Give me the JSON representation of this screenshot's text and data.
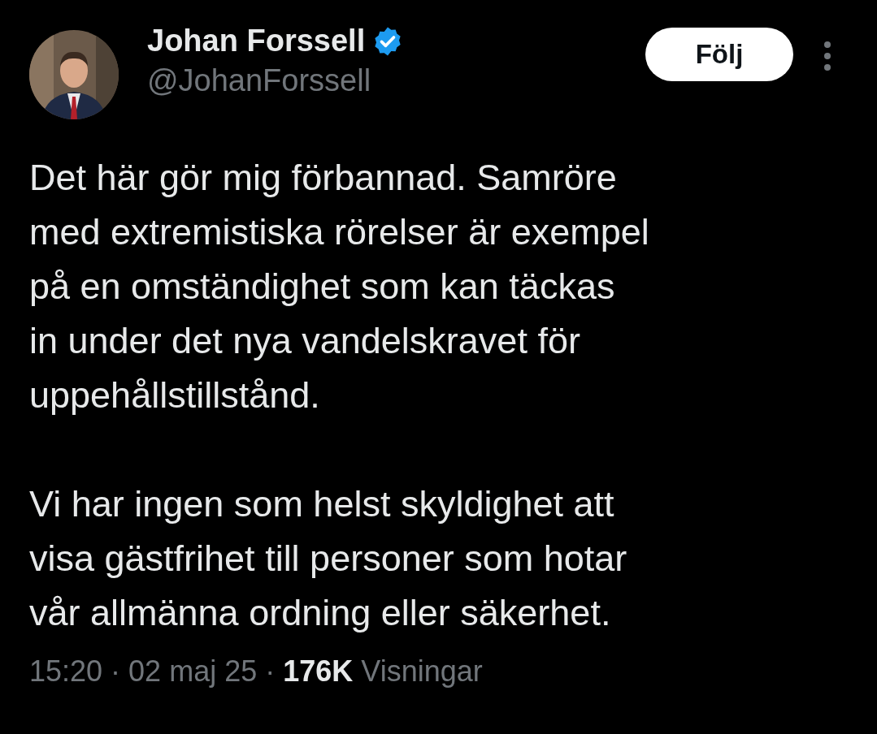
{
  "author": {
    "name": "Johan Forssell",
    "handle": "@JohanForssell",
    "verified": true
  },
  "follow_button": "Följ",
  "paragraphs": [
    "Det här gör mig förbannad. Samröre\nmed extremistiska rörelser är exempel\npå en omständighet som kan täckas\nin under det nya vandelskravet för\nuppehållstillstånd.",
    "Vi har ingen som helst skyldighet att\nvisa gästfrihet till personer som hotar\nvår allmänna ordning eller säkerhet."
  ],
  "meta": {
    "time": "15:20",
    "separator_1": "·",
    "date": "02 maj 25",
    "separator_2": "·",
    "views": "176K",
    "views_label": "Visningar"
  }
}
